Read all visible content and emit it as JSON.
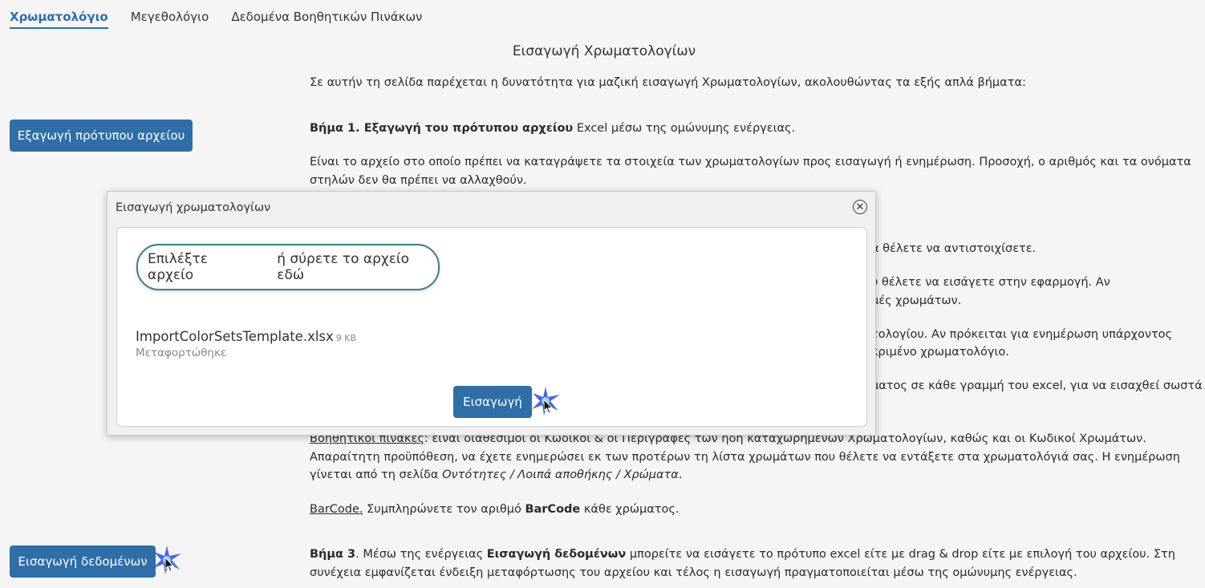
{
  "tabs": [
    {
      "label": "Χρωματολόγιο",
      "active": true
    },
    {
      "label": "Μεγεθολόγιο",
      "active": false
    },
    {
      "label": "Δεδομένα Βοηθητικών Πινάκων",
      "active": false
    }
  ],
  "page_title": "Εισαγωγή Χρωματολογίων",
  "intro": "Σε αυτήν τη σελίδα παρέχεται η δυνατότητα για μαζική εισαγωγή Χρωματολογίων, ακολουθώντας τα εξής απλά βήματα:",
  "export_button": "Εξαγωγή πρότυπου αρχείου",
  "import_data_button": "Εισαγωγή δεδομένων",
  "step1": {
    "prefix": "Βήμα 1",
    "bold": ". Εξαγωγή του πρότυπου αρχείου",
    "rest": " Excel μέσω της ομώνυμης ενέργειας.",
    "desc": "Είναι το αρχείο στο οποίο πρέπει να καταγράψετε τα στοιχεία των χρωματολογίων προς εισαγωγή ή ενημέρωση. Προσοχή, ο αριθμός και τα ονόματα στηλών δεν θα πρέπει να αλλαχθούν."
  },
  "partial": {
    "line1": "α θέλετε να αντιστοιχίσετε.",
    "line2a": "υ θέλετε να εισάγετε στην εφαρμογή. Αν",
    "line2b": "μές χρωμάτων.",
    "line3a": "τολογίου. Αν πρόκειται για ενημέρωση υπάρχοντος",
    "line3b": "κριμένο χρωματολόγιο.",
    "line4": "ματος σε κάθε γραμμή του excel, για να εισαχθεί σωστά"
  },
  "aux": {
    "link": "Βοηθητικοί πίνακες",
    "text": ": είναι διαθέσιμοι οι Κωδικοί & οι Περιγραφές των ήδη καταχωρημένων Χρωματολογίων, καθώς και οι Κωδικοί Χρωμάτων. Απαραίτητη προϋπόθεση, να έχετε ενημερώσει εκ των προτέρων τη λίστα χρωμάτων που θέλετε να εντάξετε στα χρωματολόγιά σας. Η ενημέρωση γίνεται από τη σελίδα ",
    "path": "Οντότητες / Λοιπά αποθήκης / Χρώματα",
    "end": "."
  },
  "barcode": {
    "link": "BarCode.",
    "text": " Συμπληρώνετε τον αριθμό ",
    "bold": "BarCode",
    "end": " κάθε χρώματος."
  },
  "step3": {
    "prefix": "Βήμα 3",
    "t1": ". Μέσω της ενέργειας ",
    "bold": "Εισαγωγή δεδομένων",
    "t2": " μπορείτε να εισάγετε το πρότυπο excel είτε με drag & drop είτε με επιλογή του αρχείου. Στη συνέχεια εμφανίζεται ένδειξη μεταφόρτωσης του αρχείου και τέλος η εισαγωγή πραγματοποιείται μέσω της ομώνυμης ενέργειας."
  },
  "modal": {
    "title": "Εισαγωγή χρωματολογίων",
    "close_glyph": "✕",
    "select_file": "Επιλέξτε αρχείο",
    "drop_hint": "ή σύρετε το αρχείο εδώ",
    "file_name": "ImportColorSetsTemplate.xlsx",
    "file_size": "9 KB",
    "file_status": "Μεταφορτώθηκε",
    "import_button": "Εισαγωγή"
  },
  "colors": {
    "primary": "#2f6ea7",
    "dropzone_border": "#3f7e8c"
  }
}
